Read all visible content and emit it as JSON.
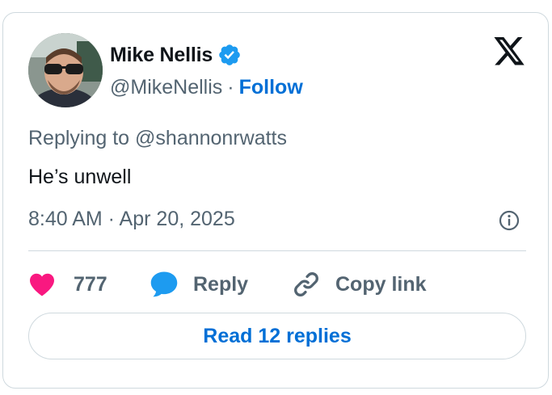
{
  "author": {
    "display_name": "Mike Nellis",
    "handle": "@MikeNellis",
    "verified": true,
    "follow_label": "Follow",
    "separator": "·"
  },
  "tweet": {
    "reply_prefix": "Replying to",
    "reply_to": "@shannonrwatts",
    "text": "He’s unwell",
    "timestamp": "8:40 AM · Apr 20, 2025"
  },
  "actions": {
    "like_count": "777",
    "reply_label": "Reply",
    "copy_link_label": "Copy link"
  },
  "read_replies_label": "Read 12 replies",
  "icons": {
    "brand": "x-logo-icon",
    "verified": "verified-badge-icon",
    "info": "info-icon",
    "like": "heart-icon",
    "reply": "speech-bubble-icon",
    "copy_link": "link-icon"
  },
  "colors": {
    "link_blue": "#006fd6",
    "verified_blue": "#1d9bf0",
    "like_pink": "#f91880",
    "muted_text": "#536471",
    "border": "#cfd9de"
  }
}
